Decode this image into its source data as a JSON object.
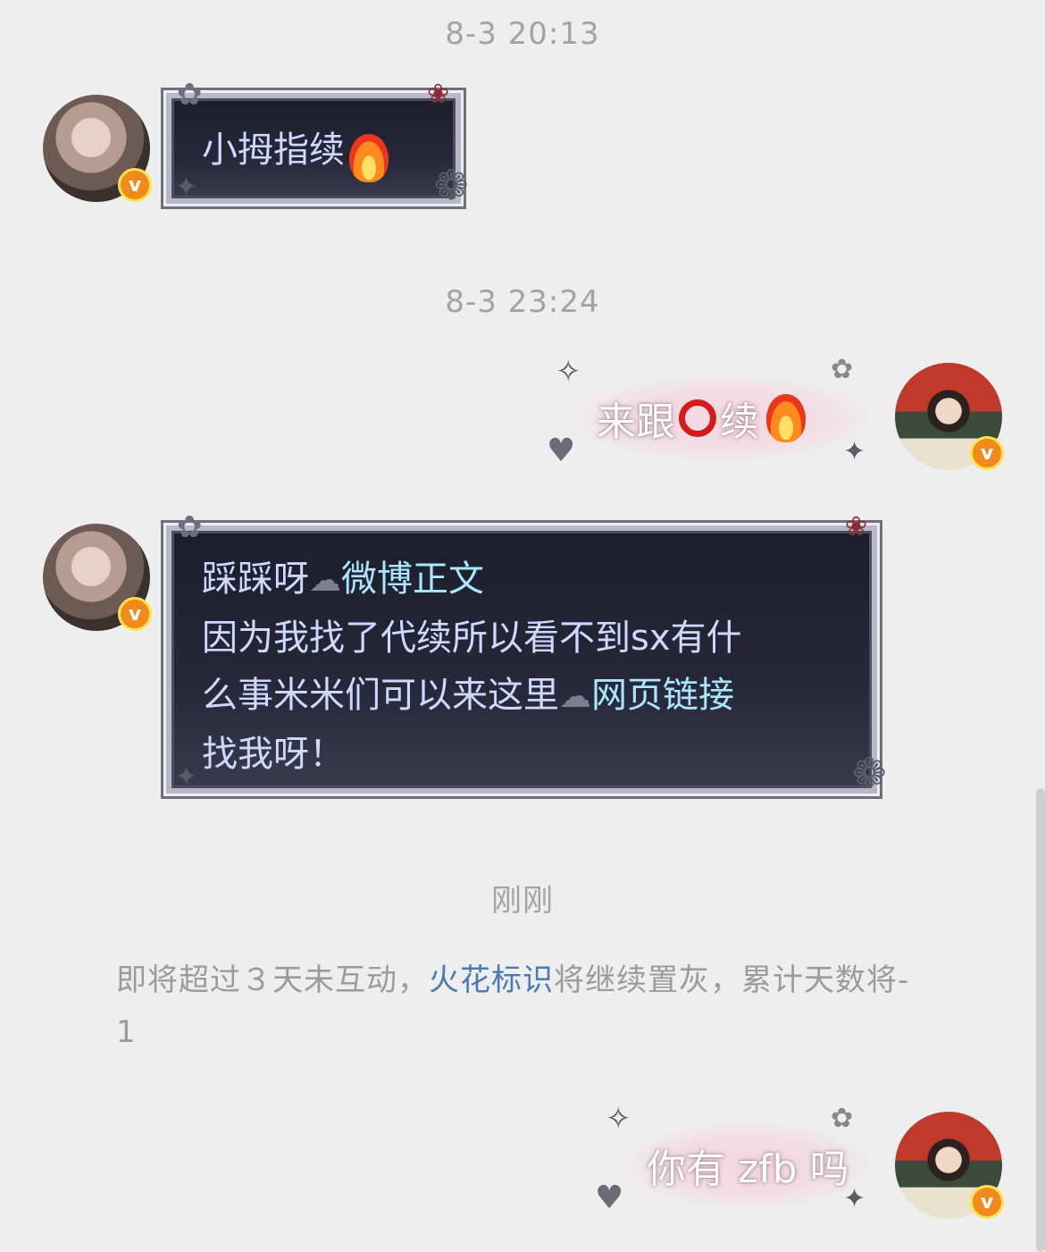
{
  "messages": [
    {
      "type": "timestamp",
      "text": "8-3 20:13"
    },
    {
      "type": "incoming",
      "sender": "left-user",
      "text": "小拇指续"
    },
    {
      "type": "timestamp",
      "text": "8-3 23:24"
    },
    {
      "type": "outgoing",
      "sender": "right-user",
      "text_before": "来跟",
      "text_after": "续"
    },
    {
      "type": "incoming",
      "sender": "left-user",
      "line1_prefix": "踩踩呀",
      "line1_link": "微博正文",
      "line2": "因为我找了代续所以看不到sx有什",
      "line3_prefix": "么事米米们可以来这里",
      "line3_link": "网页链接",
      "line4": "找我呀！"
    },
    {
      "type": "timestamp",
      "text": "刚刚"
    },
    {
      "type": "notice",
      "prefix": "即将超过３天未互动，",
      "link": "火花标识",
      "suffix": "将继续置灰，累计天数将-",
      "tail": "1"
    },
    {
      "type": "outgoing",
      "sender": "right-user",
      "text": "你有 zfb 吗"
    }
  ],
  "badges": {
    "verified_letter": "v"
  },
  "icons": [
    "cloud-link-icon",
    "fire-emoji-icon",
    "red-ring-emoji-icon",
    "verified-badge-icon"
  ],
  "colors": {
    "background": "#eeeeee",
    "timestamp": "#a3a3a3",
    "link": "#4a7bb5",
    "dark_bubble": "#1c1e2c"
  }
}
